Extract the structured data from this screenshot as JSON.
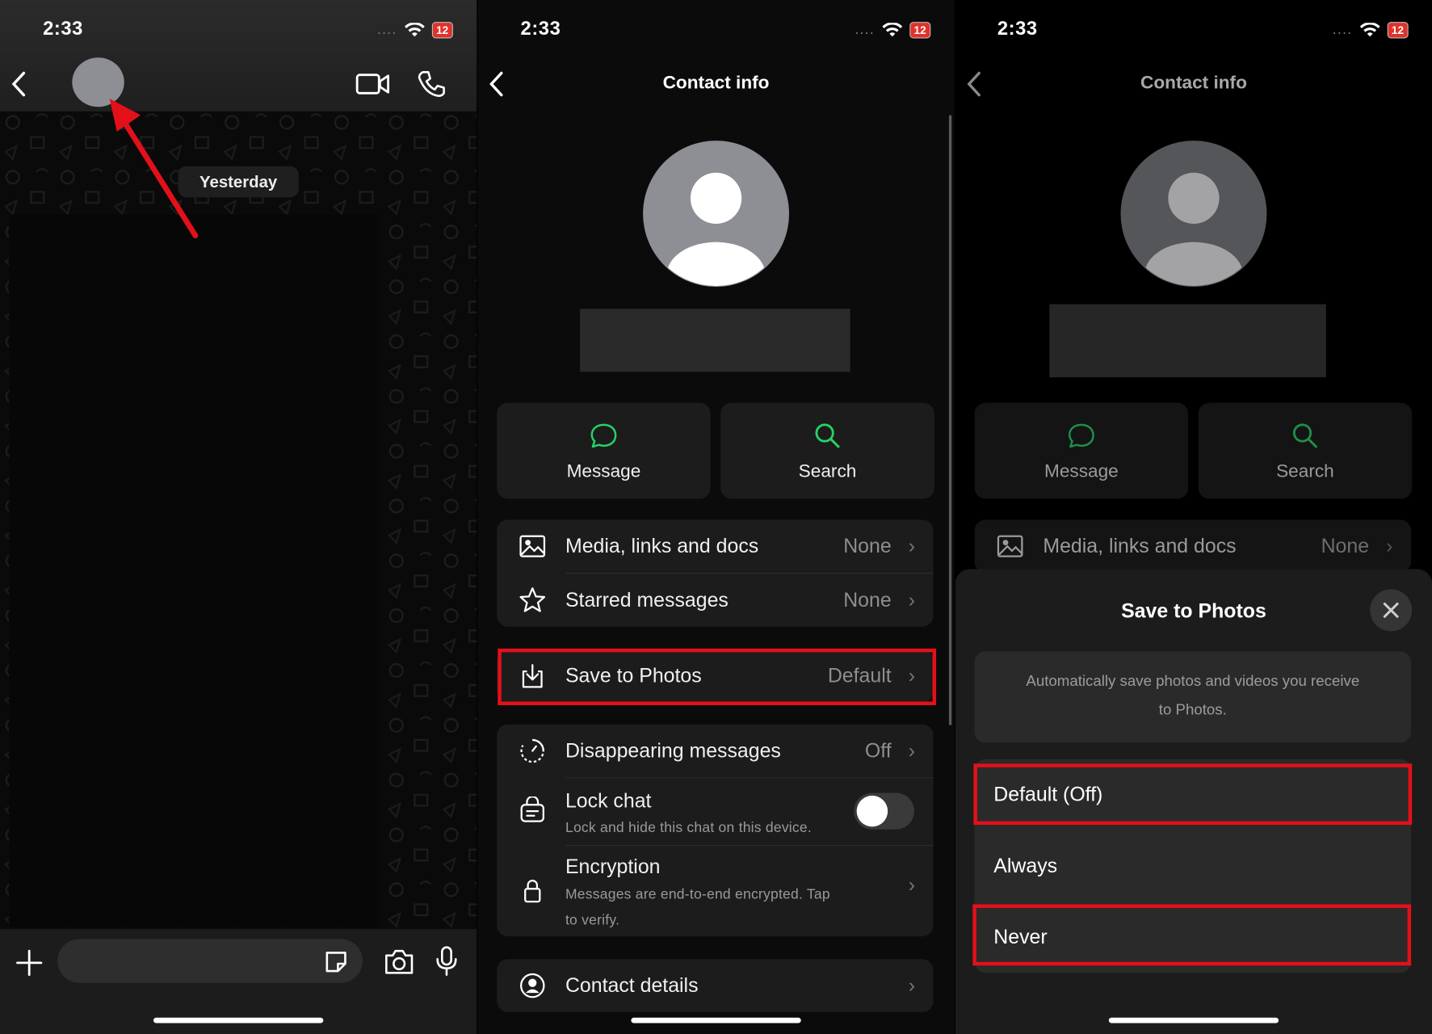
{
  "status_bar": {
    "time": "2:33",
    "signal": "....",
    "battery": "12"
  },
  "panel1": {
    "date_chip": "Yesterday"
  },
  "panel2": {
    "title": "Contact info",
    "actions": [
      {
        "label": "Message",
        "icon": "message-bubble-icon"
      },
      {
        "label": "Search",
        "icon": "search-icon"
      }
    ],
    "rows_group1": [
      {
        "label": "Media, links and docs",
        "value": "None",
        "icon": "image-icon"
      },
      {
        "label": "Starred messages",
        "value": "None",
        "icon": "star-icon"
      }
    ],
    "save_row": {
      "label": "Save to Photos",
      "value": "Default",
      "icon": "download-icon"
    },
    "disappearing": {
      "label": "Disappearing messages",
      "value": "Off",
      "icon": "timer-icon"
    },
    "lock_chat": {
      "label": "Lock chat",
      "sub": "Lock and hide this chat on this device.",
      "icon": "lock-chat-icon"
    },
    "encryption": {
      "label": "Encryption",
      "sub1": "Messages are end-to-end encrypted. Tap",
      "sub2": "to verify.",
      "icon": "lock-icon"
    },
    "contact_details": {
      "label": "Contact details",
      "icon": "contact-icon"
    }
  },
  "panel3": {
    "title": "Contact info",
    "actions": [
      {
        "label": "Message"
      },
      {
        "label": "Search"
      }
    ],
    "media_row": {
      "label": "Media, links and docs",
      "value": "None"
    },
    "sheet": {
      "title": "Save to Photos",
      "desc1": "Automatically save photos and videos you receive",
      "desc2": "to Photos.",
      "options": [
        "Default (Off)",
        "Always",
        "Never"
      ]
    }
  },
  "colors": {
    "accent_green": "#25d366",
    "highlight_red": "#e3101a"
  }
}
